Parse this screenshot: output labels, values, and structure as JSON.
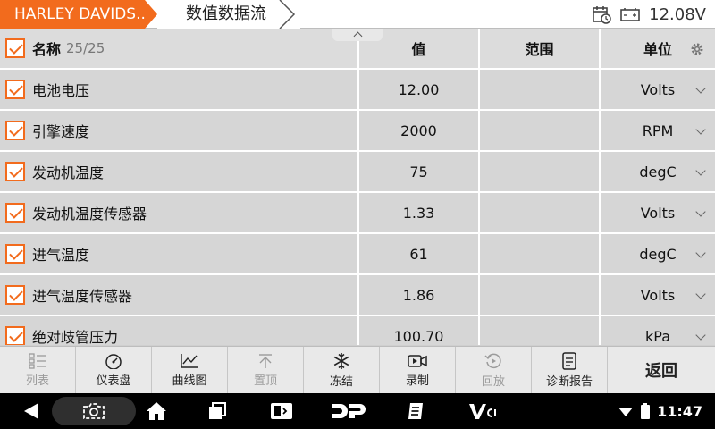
{
  "topbar": {
    "make_tab": "HARLEY DAVIDS...",
    "flow_tab": "数值数据流",
    "battery_voltage": "12.08V"
  },
  "table": {
    "headers": {
      "name": "名称",
      "count": "25/25",
      "value": "值",
      "range": "范围",
      "unit": "单位"
    },
    "rows": [
      {
        "name": "电池电压",
        "value": "12.00",
        "range": "",
        "unit": "Volts"
      },
      {
        "name": "引擎速度",
        "value": "2000",
        "range": "",
        "unit": "RPM"
      },
      {
        "name": "发动机温度",
        "value": "75",
        "range": "",
        "unit": "degC"
      },
      {
        "name": "发动机温度传感器",
        "value": "1.33",
        "range": "",
        "unit": "Volts"
      },
      {
        "name": "进气温度",
        "value": "61",
        "range": "",
        "unit": "degC"
      },
      {
        "name": "进气温度传感器",
        "value": "1.86",
        "range": "",
        "unit": "Volts"
      },
      {
        "name": "绝对歧管压力",
        "value": "100.70",
        "range": "",
        "unit": "kPa"
      }
    ]
  },
  "toolbar": {
    "list": "列表",
    "dashboard": "仪表盘",
    "graph": "曲线图",
    "pin_top": "置顶",
    "freeze": "冻结",
    "record": "录制",
    "playback": "回放",
    "report": "诊断报告",
    "back": "返回"
  },
  "statusbar": {
    "time": "11:47"
  },
  "colors": {
    "accent": "#f26b1d",
    "row_bg": "#d6d6d6",
    "toolbar_bg": "#e9e9e9"
  }
}
